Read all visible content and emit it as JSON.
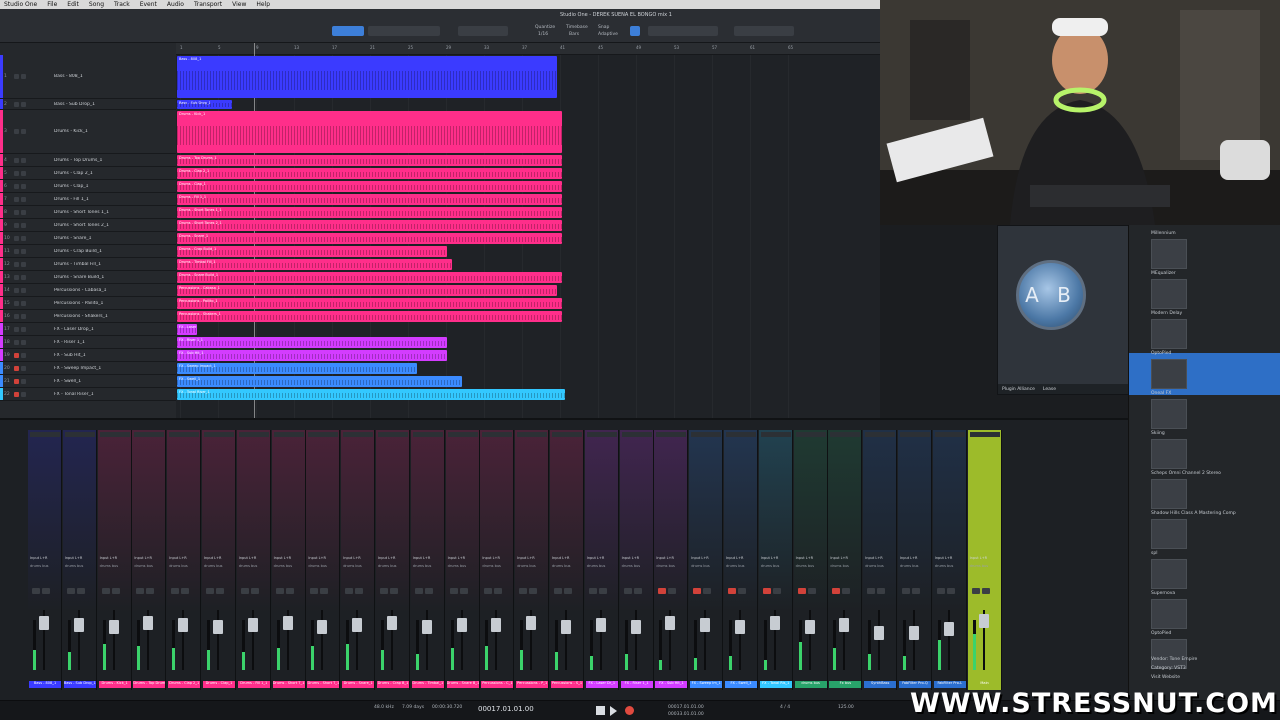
{
  "menubar": {
    "items": [
      "Studio One",
      "File",
      "Edit",
      "Song",
      "Track",
      "Event",
      "Audio",
      "Transport",
      "View",
      "Help"
    ]
  },
  "toolbar": {
    "song_title": "Studio One - DEREK SUENA EL BONGO mix 1",
    "quantize_label": "Quantize",
    "quantize_value": "1/16",
    "timebase_label": "Timebase",
    "timebase_value": "Bars",
    "snap_label": "Snap",
    "snap_value": "Adaptive"
  },
  "tracks": [
    {
      "num": "1",
      "name": "Bass - 808_1",
      "color": "#3b3bff",
      "mute": false
    },
    {
      "num": "2",
      "name": "Bass - Sub Drop_1",
      "color": "#3b3bff",
      "mute": false
    },
    {
      "num": "3",
      "name": "Drums - Kick_1",
      "color": "#ff2e8a",
      "mute": false
    },
    {
      "num": "4",
      "name": "Drums - Top Drums_1",
      "color": "#ff2e8a",
      "mute": false
    },
    {
      "num": "5",
      "name": "Drums - Clap 2_1",
      "color": "#ff2e8a",
      "mute": false
    },
    {
      "num": "6",
      "name": "Drums - Clap_1",
      "color": "#ff2e8a",
      "mute": false
    },
    {
      "num": "7",
      "name": "Drums - Fill 1_1",
      "color": "#ff2e8a",
      "mute": false
    },
    {
      "num": "8",
      "name": "Drums - Short Tones 1_1",
      "color": "#ff2e8a",
      "mute": false
    },
    {
      "num": "9",
      "name": "Drums - Short Tones 2_1",
      "color": "#ff2e8a",
      "mute": false
    },
    {
      "num": "10",
      "name": "Drums - Snare_1",
      "color": "#ff2e8a",
      "mute": false
    },
    {
      "num": "11",
      "name": "Drums - Crap Build_1",
      "color": "#ff2e8a",
      "mute": false
    },
    {
      "num": "12",
      "name": "Drums - Timbal Fill_1",
      "color": "#ff2e8a",
      "mute": false
    },
    {
      "num": "13",
      "name": "Drums - Snare Build_1",
      "color": "#ff2e8a",
      "mute": false
    },
    {
      "num": "14",
      "name": "Percussions - Cabasa_1",
      "color": "#ff2e8a",
      "mute": false
    },
    {
      "num": "15",
      "name": "Percussions - Pailito_1",
      "color": "#ff2e8a",
      "mute": false
    },
    {
      "num": "16",
      "name": "Percussions - Shakers_1",
      "color": "#ff2e8a",
      "mute": false
    },
    {
      "num": "17",
      "name": "FX - Laser Drop_1",
      "color": "#d33cff",
      "mute": false
    },
    {
      "num": "18",
      "name": "FX - Riser 1_1",
      "color": "#d33cff",
      "mute": false
    },
    {
      "num": "19",
      "name": "FX - Sub Hit_1",
      "color": "#d33cff",
      "mute": true
    },
    {
      "num": "20",
      "name": "FX - Sweep Impact_1",
      "color": "#3b8bff",
      "mute": true
    },
    {
      "num": "21",
      "name": "FX - Swell_1",
      "color": "#3b8bff",
      "mute": true
    },
    {
      "num": "22",
      "name": "FX - Tonal Riser_1",
      "color": "#33c8ff",
      "mute": true
    }
  ],
  "ruler_marks": [
    "1",
    "5",
    "9",
    "13",
    "17",
    "21",
    "25",
    "29",
    "33",
    "37",
    "41",
    "45",
    "49",
    "53",
    "57",
    "61",
    "65"
  ],
  "mixer": {
    "input_label": "Input L+R",
    "bus_label": "drums bus",
    "strips": [
      {
        "label": "Bass - 808_1",
        "color": "#3b3bff",
        "mute": false
      },
      {
        "label": "Bass - Sub Drop_1",
        "color": "#3b3bff",
        "mute": false
      },
      {
        "label": "Drums - Kick_1",
        "color": "#ff2e8a",
        "mute": false
      },
      {
        "label": "Drums - Top Drums_1",
        "color": "#ff2e8a",
        "mute": false
      },
      {
        "label": "Drums - Clap 2_1",
        "color": "#ff2e8a",
        "mute": false
      },
      {
        "label": "Drums - Clap_1",
        "color": "#ff2e8a",
        "mute": false
      },
      {
        "label": "Drums - Fill 1_1",
        "color": "#ff2e8a",
        "mute": false
      },
      {
        "label": "Drums - Short T_1",
        "color": "#ff2e8a",
        "mute": false
      },
      {
        "label": "Drums - Short T_1",
        "color": "#ff2e8a",
        "mute": false
      },
      {
        "label": "Drums - Snare_1",
        "color": "#ff2e8a",
        "mute": false
      },
      {
        "label": "Drums - Crap B_1",
        "color": "#ff2e8a",
        "mute": false
      },
      {
        "label": "Drums - Timbal_1",
        "color": "#ff2e8a",
        "mute": false
      },
      {
        "label": "Drums - Snare B_1",
        "color": "#ff2e8a",
        "mute": false
      },
      {
        "label": "Percussions - C_1",
        "color": "#ff2e8a",
        "mute": false
      },
      {
        "label": "Percussions - P_1",
        "color": "#ff2e8a",
        "mute": false
      },
      {
        "label": "Percussions - S_1",
        "color": "#ff2e8a",
        "mute": false
      },
      {
        "label": "FX - Laser Dr_1",
        "color": "#d33cff",
        "mute": false
      },
      {
        "label": "FX - Riser 1_1",
        "color": "#d33cff",
        "mute": false
      },
      {
        "label": "FX - Sub Hit_1",
        "color": "#d33cff",
        "mute": true
      },
      {
        "label": "FX - Sweep Im_1",
        "color": "#3b8bff",
        "mute": true
      },
      {
        "label": "FX - Swell_1",
        "color": "#3b8bff",
        "mute": true
      },
      {
        "label": "FX - Tonal Ris_1",
        "color": "#33c8ff",
        "mute": true
      },
      {
        "label": "drums bus",
        "color": "#28a36a",
        "mute": true
      },
      {
        "label": "Fx bus",
        "color": "#28a36a",
        "mute": true
      },
      {
        "label": "SynthBass",
        "color": "#2b6fd0",
        "mute": false
      },
      {
        "label": "FabFilter Pro-Q",
        "color": "#2b6fd0",
        "mute": false
      },
      {
        "label": "FabFilter Pro-L",
        "color": "#2b6fd0",
        "mute": false
      },
      {
        "label": "Main",
        "color": "#9dbb2a",
        "mute": false
      }
    ]
  },
  "plugin": {
    "knob_label": "A B",
    "footer_brand": "Plugin Alliance",
    "footer_license": "Lease"
  },
  "browser": {
    "items": [
      "Millennium",
      "MEqualizer",
      "Modern Delay",
      "OptoPied",
      "Oneal FX",
      "Skiing",
      "Scheps Omni Channel 2 Stereo",
      "Shadow Hills Class A Mastering Comp",
      "spl",
      "Supernova",
      "OptoPied"
    ],
    "info_vendor": "Vendor: Tone Empire",
    "info_category": "Category: VST3",
    "info_website": "Visit Website"
  },
  "transport": {
    "sample_rate": "48.0 kHz",
    "record_time": "7.09 days",
    "time_display": "00:00:30.720",
    "position": "00017.01.01.00",
    "loop_start": "00017.01.01.00",
    "loop_end": "00033.01.01.00",
    "signature": "4 / 4",
    "tempo": "125.00"
  },
  "watermark": "WWW.STRESSNUT.COM"
}
